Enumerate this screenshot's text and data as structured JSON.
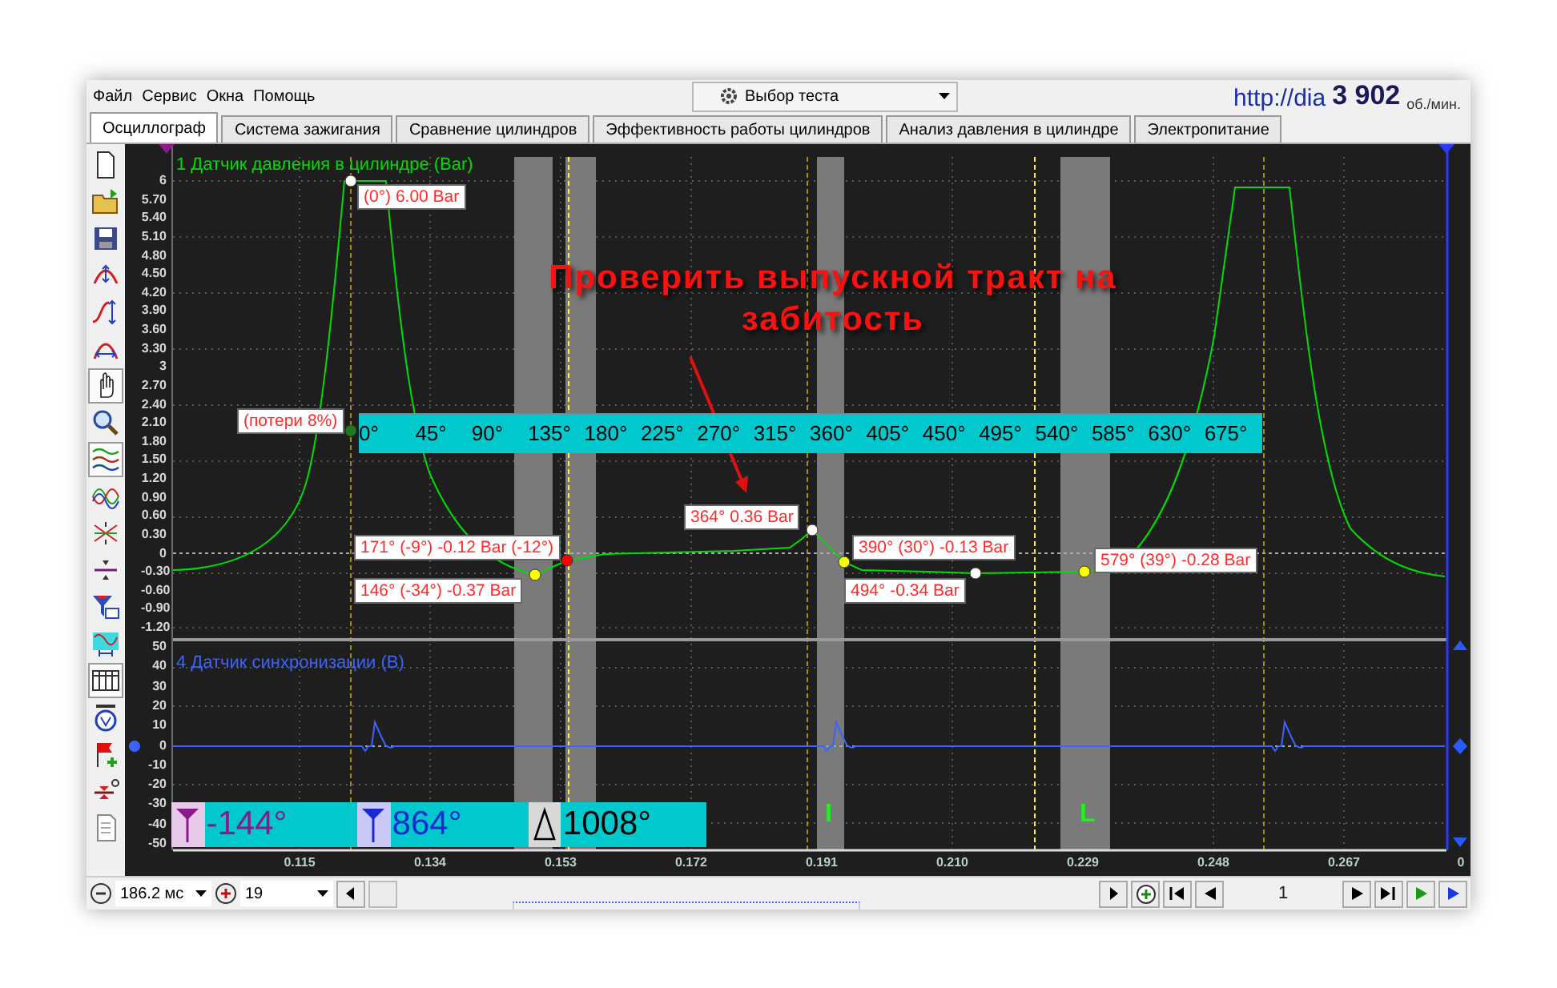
{
  "menu": [
    "Файл",
    "Сервис",
    "Окна",
    "Помощь"
  ],
  "test_selector": {
    "value": "Выбор теста"
  },
  "header_right": {
    "url": "http://dia",
    "rpm": "3 902",
    "rpm_unit": "об./мин."
  },
  "tabs": [
    {
      "label": "Осциллограф",
      "selected": true
    },
    {
      "label": "Система зажигания",
      "selected": false
    },
    {
      "label": "Сравнение цилиндров",
      "selected": false
    },
    {
      "label": "Эффективность работы цилиндров",
      "selected": false
    },
    {
      "label": "Анализ давления в цилиндре",
      "selected": false
    },
    {
      "label": "Электропитание",
      "selected": false
    }
  ],
  "tools": [
    {
      "kind": "new",
      "selected": false
    },
    {
      "kind": "open",
      "selected": false
    },
    {
      "kind": "save",
      "selected": false
    },
    {
      "kind": "auto",
      "selected": false
    },
    {
      "kind": "vscale",
      "selected": false
    },
    {
      "kind": "hscale",
      "selected": false
    },
    {
      "kind": "hand",
      "selected": true
    },
    {
      "kind": "zoom",
      "selected": false
    },
    {
      "kind": "stack",
      "selected": true
    },
    {
      "kind": "overlay",
      "selected": false
    },
    {
      "kind": "invert",
      "selected": false
    },
    {
      "kind": "level",
      "selected": false
    },
    {
      "kind": "filter",
      "selected": false
    },
    {
      "kind": "sync",
      "selected": false
    },
    {
      "kind": "grid",
      "selected": true
    },
    {
      "kind": "autov",
      "selected": false
    },
    {
      "kind": "flag",
      "selected": false
    },
    {
      "kind": "zero",
      "selected": false
    },
    {
      "kind": "report",
      "selected": false
    }
  ],
  "channels": [
    {
      "title": "1 Датчик давления в цилиндре (Bar)",
      "color": "#00dd00",
      "y_ticks": [
        "6",
        "5.70",
        "5.40",
        "5.10",
        "4.80",
        "4.50",
        "4.20",
        "3.90",
        "3.60",
        "3.30",
        "3",
        "2.70",
        "2.40",
        "2.10",
        "1.80",
        "1.50",
        "1.20",
        "0.90",
        "0.60",
        "0.30",
        "0",
        "-0.30",
        "-0.60",
        "-0.90",
        "-1.20"
      ]
    },
    {
      "title": "4 Датчик синхронизации (В)",
      "color": "#3b63ff",
      "y_ticks": [
        "50",
        "40",
        "30",
        "20",
        "10",
        "0",
        "-10",
        "-20",
        "-30",
        "-40",
        "-50"
      ]
    }
  ],
  "x_ticks": [
    "0.115",
    "0.134",
    "0.153",
    "0.172",
    "0.191",
    "0.210",
    "0.229",
    "0.248",
    "0.267",
    "0"
  ],
  "degree_scale": [
    "0°",
    "45°",
    "90°",
    "135°",
    "180°",
    "225°",
    "270°",
    "315°",
    "360°",
    "405°",
    "450°",
    "495°",
    "540°",
    "585°",
    "630°",
    "675°"
  ],
  "annotations": [
    {
      "text": "(0°) 6.00 Bar",
      "color": "#ffffff"
    },
    {
      "text": "(потери 8%)",
      "color": "#1e7a1e"
    },
    {
      "text": "171° (-9°) -0.12 Bar (-12°)",
      "color": "#ff0000"
    },
    {
      "text": "146° (-34°) -0.37 Bar",
      "color": "#ffff00"
    },
    {
      "text": "364° 0.36 Bar",
      "color": "#ffffff"
    },
    {
      "text": "390° (30°) -0.13 Bar",
      "color": "#ffff00"
    },
    {
      "text": "494° -0.34 Bar",
      "color": "#ffffff"
    },
    {
      "text": "579° (39°) -0.28 Bar",
      "color": "#ffff00"
    }
  ],
  "note": "Проверить выпускной тракт на забитость",
  "sync_marks": [
    "I",
    "L"
  ],
  "cursor_readouts": [
    {
      "kind": "cursor1",
      "value": "-144°"
    },
    {
      "kind": "cursor2",
      "value": "864°"
    },
    {
      "kind": "delta",
      "value": "1008°"
    }
  ],
  "bottom_bar": {
    "time_span": "186.2 мс",
    "count": "19",
    "page": "1"
  }
}
